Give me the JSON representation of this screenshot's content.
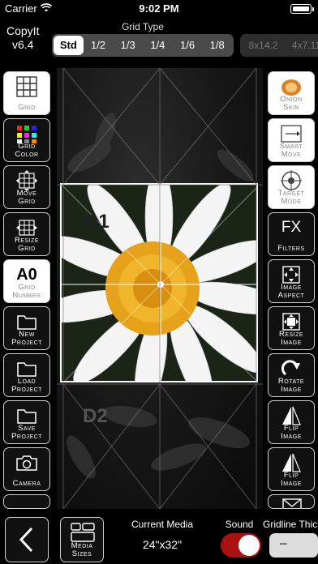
{
  "status": {
    "carrier": "Carrier",
    "time": "9:02 PM"
  },
  "app": {
    "name": "CopyIt",
    "version": "v6.4"
  },
  "grid_type": {
    "label": "Grid Type",
    "options": [
      "Std",
      "1/2",
      "1/3",
      "1/4",
      "1/6",
      "1/8"
    ],
    "selected": "Std",
    "size_options": [
      "8x14.2",
      "4x7.11"
    ]
  },
  "left_tools": [
    {
      "label1": "Grid",
      "label2": "",
      "icon": "grid-icon",
      "lit": true
    },
    {
      "label1": "Grid",
      "label2": "Color",
      "icon": "color-palette-icon"
    },
    {
      "label1": "Move",
      "label2": "Grid",
      "icon": "move-grid-icon"
    },
    {
      "label1": "Resize",
      "label2": "Grid",
      "icon": "resize-grid-icon"
    },
    {
      "label1": "Grid",
      "label2": "Number",
      "icon": "grid-number-icon",
      "lit": true,
      "big": "A0"
    },
    {
      "label1": "New",
      "label2": "Project",
      "icon": "folder-icon"
    },
    {
      "label1": "Load",
      "label2": "Project",
      "icon": "folder-icon"
    },
    {
      "label1": "Save",
      "label2": "Project",
      "icon": "folder-icon"
    },
    {
      "label1": "Camera",
      "label2": "",
      "icon": "camera-icon"
    }
  ],
  "right_tools": [
    {
      "label1": "Onion",
      "label2": "Skin",
      "icon": "onion-icon",
      "lit": true
    },
    {
      "label1": "Smart",
      "label2": "Move",
      "icon": "smart-move-icon",
      "lit": true
    },
    {
      "label1": "Target",
      "label2": "Mode",
      "icon": "target-icon",
      "lit": true
    },
    {
      "label1": "Filters",
      "label2": "",
      "icon": "fx-icon",
      "fx": "FX"
    },
    {
      "label1": "Image",
      "label2": "Aspect",
      "icon": "image-aspect-icon"
    },
    {
      "label1": "Resize",
      "label2": "Image",
      "icon": "resize-image-icon"
    },
    {
      "label1": "Rotate",
      "label2": "Image",
      "icon": "rotate-icon"
    },
    {
      "label1": "Flip",
      "label2": "Image",
      "icon": "flip-horizontal-icon"
    },
    {
      "label1": "Flip",
      "label2": "Image",
      "icon": "flip-vertical-icon"
    }
  ],
  "canvas": {
    "cell_label_1": "D1",
    "cell_label_2": "D2"
  },
  "bottom": {
    "media_sizes_label1": "Media",
    "media_sizes_label2": "Sizes",
    "current_media_label": "Current Media",
    "current_media_value": "24\"x32\"",
    "sound_label": "Sound",
    "sound_on": true,
    "gridline_label": "Gridline Thick",
    "stepper_minus": "−"
  },
  "colors": {
    "accent_toggle": "#aa1111",
    "panel_border": "#cfcfcf"
  }
}
